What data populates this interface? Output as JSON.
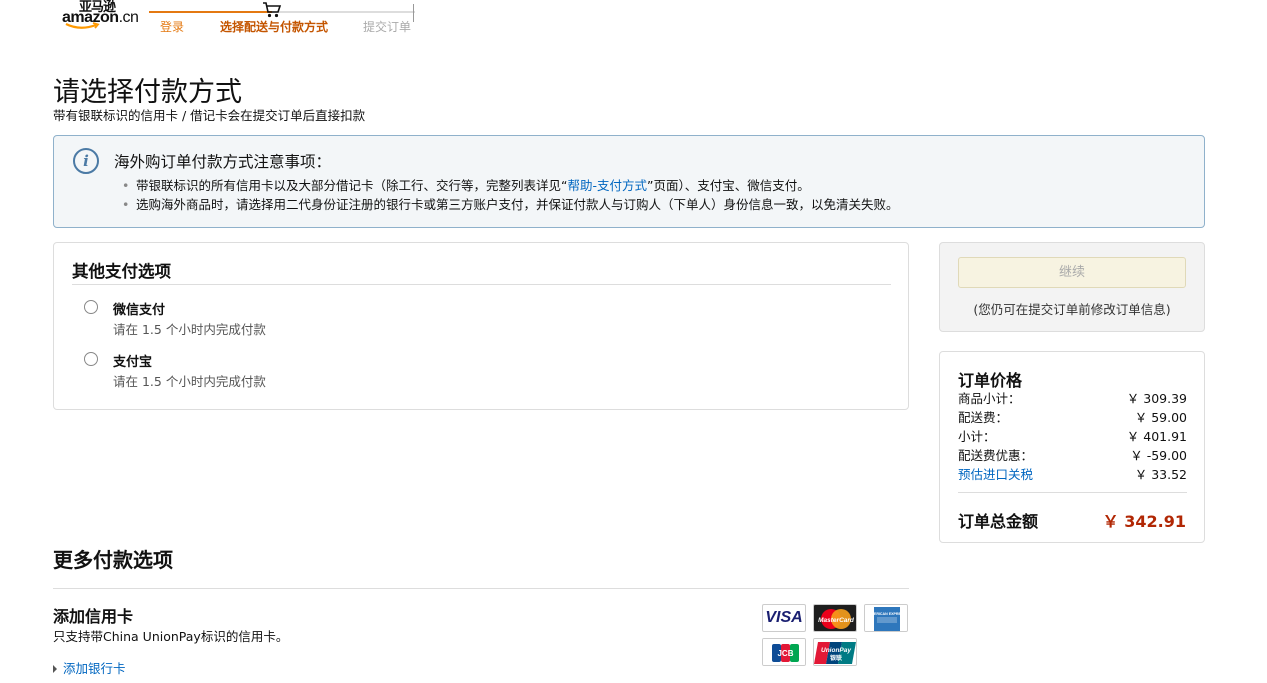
{
  "header": {
    "logo_cn": "亚马逊",
    "logo_en": "amazon",
    "logo_domain": ".cn",
    "steps": [
      {
        "label": "登录"
      },
      {
        "label": "选择配送与付款方式"
      },
      {
        "label": "提交订单"
      }
    ]
  },
  "page": {
    "title": "请选择付款方式",
    "subtitle": "带有银联标识的信用卡 / 借记卡会在提交订单后直接扣款"
  },
  "notice": {
    "title": "海外购订单付款方式注意事项：",
    "item1_before": "带银联标识的所有信用卡以及大部分借记卡（除工行、交行等，完整列表详见“",
    "item1_link": "帮助-支付方式",
    "item1_after": "”页面）、支付宝、微信支付。",
    "item2": "选购海外商品时，请选择用二代身份证注册的银行卡或第三方账户支付，并保证付款人与订购人（下单人）身份信息一致，以免清关失败。"
  },
  "other_payment": {
    "title": "其他支付选项",
    "options": [
      {
        "name": "微信支付",
        "desc": "请在 1.5 个小时内完成付款"
      },
      {
        "name": "支付宝",
        "desc": "请在 1.5 个小时内完成付款"
      }
    ]
  },
  "continue": {
    "button_label": "继续",
    "note": "(您仍可在提交订单前修改订单信息)"
  },
  "order_summary": {
    "title": "订单价格",
    "rows": [
      {
        "label": "商品小计：",
        "value": "￥ 309.39"
      },
      {
        "label": "配送费：",
        "value": "￥ 59.00"
      },
      {
        "label": "小计：",
        "value": "￥ 401.91"
      },
      {
        "label": "配送费优惠：",
        "value": "￥ -59.00"
      },
      {
        "label": "预估进口关税",
        "value": "￥ 33.52"
      }
    ],
    "total_label": "订单总金额",
    "total_value": "￥ 342.91"
  },
  "more_payment": {
    "title": "更多付款选项",
    "add_card_title": "添加信用卡",
    "add_card_desc": "只支持带China UnionPay标识的信用卡。",
    "add_bank_label": "添加银行卡",
    "cards": [
      {
        "icon": "visa-icon",
        "label": "VISA"
      },
      {
        "icon": "mastercard-icon",
        "label": "MasterCard"
      },
      {
        "icon": "amex-icon",
        "label": "AMERICAN EXPRESS"
      },
      {
        "icon": "jcb-icon",
        "label": "JCB"
      },
      {
        "icon": "unionpay-icon",
        "label": "UnionPay 银联"
      }
    ]
  },
  "colors": {
    "accent_orange": "#e47911",
    "current_step": "#c45500",
    "link_blue": "#0066c0",
    "price_red": "#b12704",
    "notice_bg": "#f3f6f8",
    "notice_border": "#8fb1cb"
  }
}
